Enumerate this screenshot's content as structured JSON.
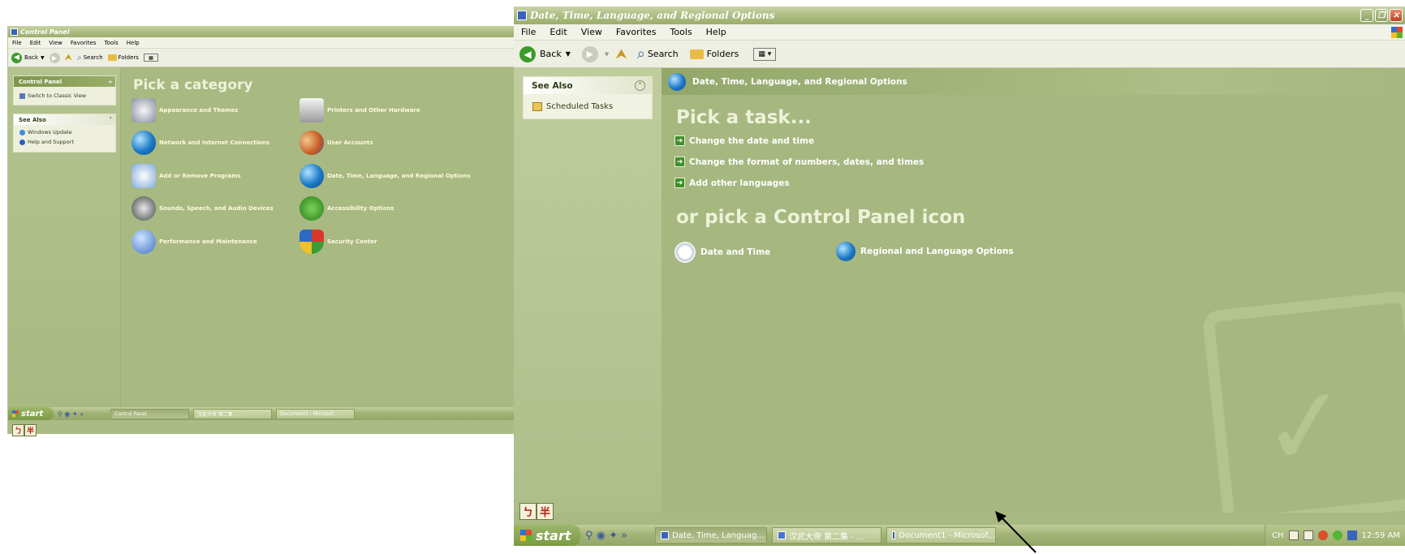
{
  "left_window": {
    "title": "Control Panel",
    "menu": [
      "File",
      "Edit",
      "View",
      "Favorites",
      "Tools",
      "Help"
    ],
    "toolbar": {
      "back": "Back",
      "search": "Search",
      "folders": "Folders"
    },
    "panel_box": {
      "title": "Control Panel",
      "item": "Switch to Classic View"
    },
    "see_also": {
      "title": "See Also",
      "items": [
        "Windows Update",
        "Help and Support"
      ]
    },
    "heading": "Pick a category",
    "categories": [
      {
        "label": "Appearance and Themes",
        "icon": "appearance-icon"
      },
      {
        "label": "Printers and Other Hardware",
        "icon": "printer-icon"
      },
      {
        "label": "Network and Internet Connections",
        "icon": "network-icon"
      },
      {
        "label": "User Accounts",
        "icon": "users-icon"
      },
      {
        "label": "Add or Remove Programs",
        "icon": "programs-icon"
      },
      {
        "label": "Date, Time, Language, and Regional Options",
        "icon": "globe-icon"
      },
      {
        "label": "Sounds, Speech, and Audio Devices",
        "icon": "sound-icon"
      },
      {
        "label": "Accessibility Options",
        "icon": "accessibility-icon"
      },
      {
        "label": "Performance and Maintenance",
        "icon": "performance-icon"
      },
      {
        "label": "Security Center",
        "icon": "shield-icon"
      }
    ],
    "ime": [
      "ㄅ",
      "半"
    ],
    "taskbar": {
      "start": "start",
      "tasks": [
        "Control Panel",
        "汉武大帝 第二集 - ...",
        "Document1 - Microsof..."
      ]
    }
  },
  "right_window": {
    "title": "Date, Time, Language, and Regional Options",
    "menu": [
      "File",
      "Edit",
      "View",
      "Favorites",
      "Tools",
      "Help"
    ],
    "toolbar": {
      "back": "Back",
      "search": "Search",
      "folders": "Folders"
    },
    "see_also": {
      "title": "See Also",
      "items": [
        "Scheduled Tasks"
      ]
    },
    "path": "Date, Time, Language, and Regional Options",
    "task_heading": "Pick a task...",
    "tasks": [
      "Change the date and time",
      "Change the format of numbers, dates, and times",
      "Add other languages"
    ],
    "icon_heading": "or pick a Control Panel icon",
    "icons": [
      {
        "label": "Date and Time",
        "icon": "clock-calendar-icon"
      },
      {
        "label": "Regional and Language Options",
        "icon": "globe-icon"
      }
    ],
    "ime": [
      "ㄅ",
      "半"
    ],
    "taskbar": {
      "start": "start",
      "tasks": [
        "Date, Time, Languag...",
        "汉武大帝 第二集 - ...",
        "Document1 - Microsof..."
      ],
      "tray": {
        "lang": "CH",
        "time": "12:59 AM"
      }
    }
  },
  "colors": {
    "olive": "#a8b981",
    "accent_green": "#3f8e2b",
    "title_text": "#ffffff"
  }
}
